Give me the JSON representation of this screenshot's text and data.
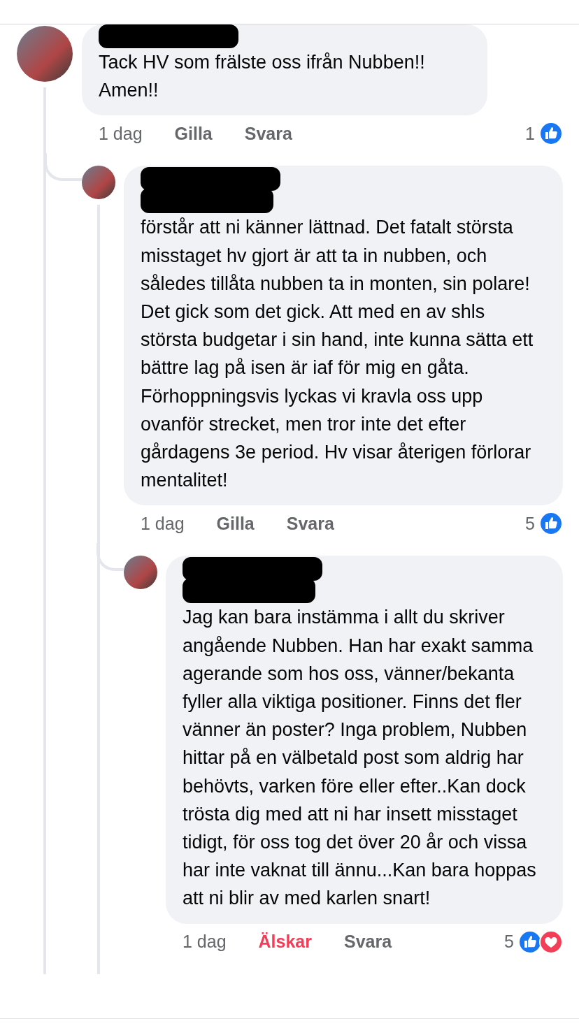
{
  "comments": [
    {
      "author_redacted": true,
      "mention_redacted": false,
      "body": "Tack HV som frälste oss ifrån Nubben!! Amen!!",
      "time": "1 dag",
      "reacted": false,
      "like_label": "Gilla",
      "reply_label": "Svara",
      "reaction_count": "1",
      "reactions": [
        {
          "kind": "like"
        }
      ],
      "children": [
        {
          "author_redacted": true,
          "mention_redacted": true,
          "body": "förstår att ni känner lättnad. Det fatalt största misstaget hv gjort är att ta in nubben, och således tillåta nubben ta in monten, sin polare! Det gick som det gick. Att med en av shls största budgetar i sin hand, inte kunna sätta ett bättre lag på isen är iaf för mig en gåta. Förhoppningsvis lyckas vi kravla oss upp ovanför strecket, men tror inte det efter gårdagens 3e period. Hv visar återigen förlorar mentalitet!",
          "time": "1 dag",
          "reacted": false,
          "like_label": "Gilla",
          "reply_label": "Svara",
          "reaction_count": "5",
          "reactions": [
            {
              "kind": "like"
            }
          ],
          "children": [
            {
              "author_redacted": true,
              "mention_redacted": true,
              "body": "Jag kan bara instämma i allt du skriver angående Nubben. Han har exakt samma agerande som hos oss, vänner/bekanta fyller alla viktiga positioner. Finns det fler vänner än poster? Inga problem, Nubben hittar på en välbetald post som aldrig har behövts, varken före eller efter..Kan dock trösta dig med att ni har insett misstaget tidigt, för oss tog det över 20 år och vissa har inte vaknat till ännu...Kan bara hoppas att ni blir av med karlen snart!",
              "time": "1 dag",
              "reacted": true,
              "like_label": "Älskar",
              "reply_label": "Svara",
              "reaction_count": "5",
              "reactions": [
                {
                  "kind": "like"
                },
                {
                  "kind": "love"
                }
              ]
            }
          ]
        }
      ]
    }
  ]
}
